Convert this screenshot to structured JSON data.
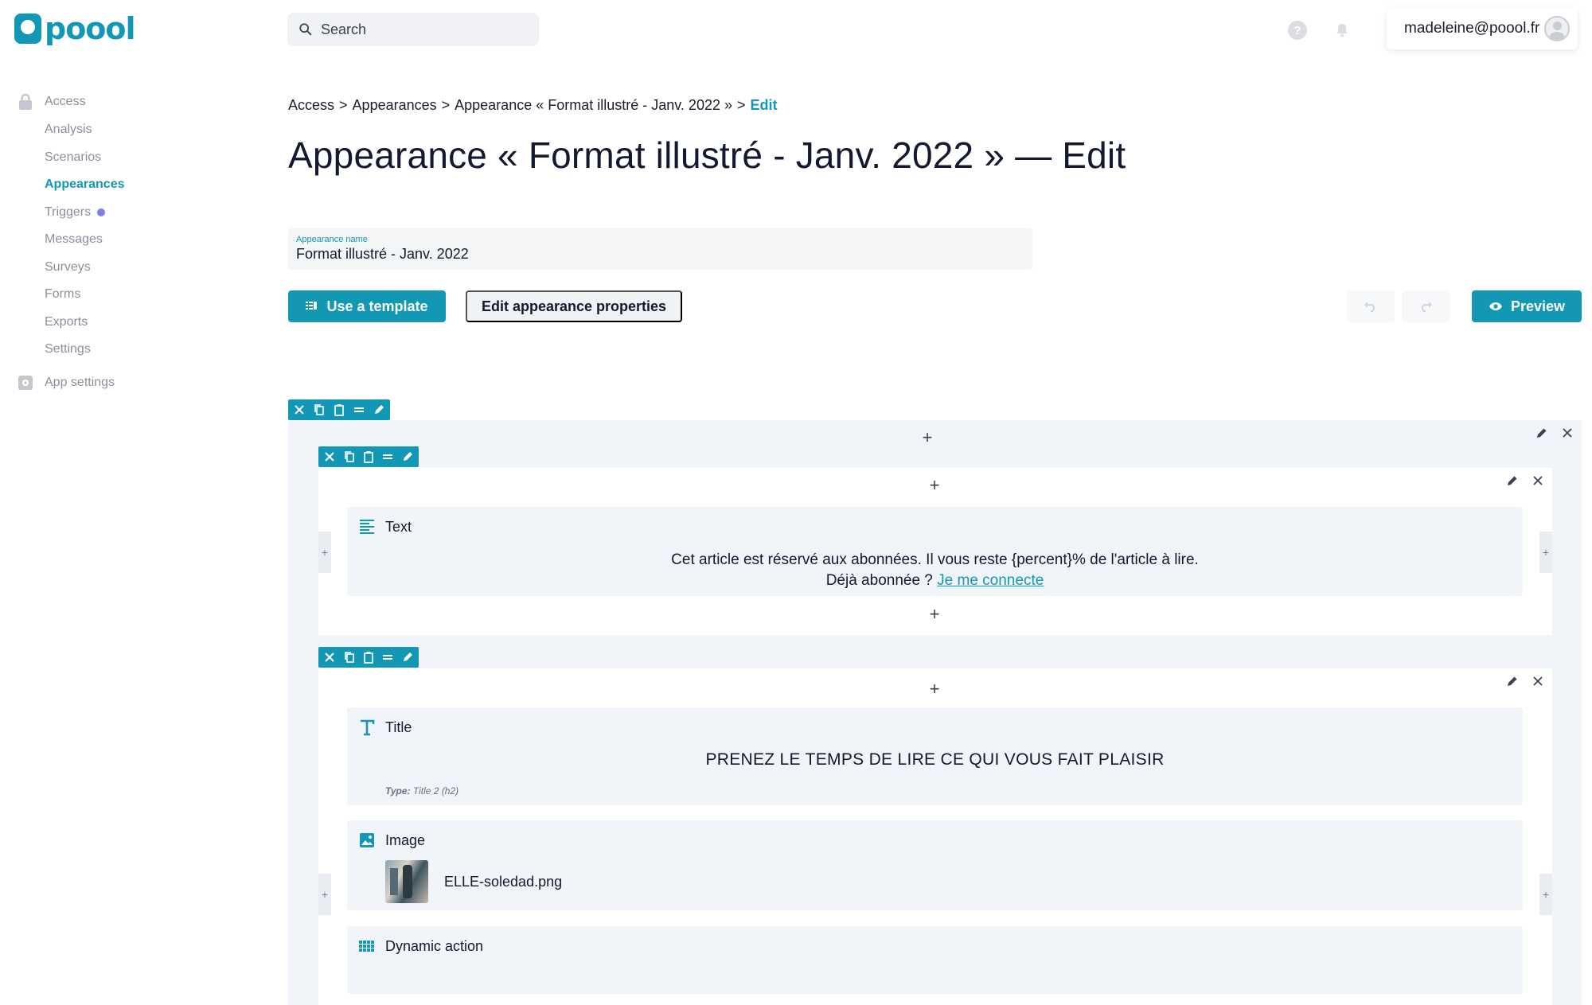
{
  "app": {
    "logo_text": "poool"
  },
  "header": {
    "search_placeholder": "Search",
    "user_email": "madeleine@poool.fr"
  },
  "sidebar": {
    "sections": [
      {
        "label": "Access",
        "icon": "lock-icon"
      },
      {
        "label": "App settings",
        "icon": "gear-icon"
      }
    ],
    "items": [
      {
        "label": "Analysis"
      },
      {
        "label": "Scenarios"
      },
      {
        "label": "Appearances",
        "active": true
      },
      {
        "label": "Triggers",
        "dot": true
      },
      {
        "label": "Messages"
      },
      {
        "label": "Surveys"
      },
      {
        "label": "Forms"
      },
      {
        "label": "Exports"
      },
      {
        "label": "Settings"
      }
    ]
  },
  "breadcrumb": {
    "items": [
      "Access",
      "Appearances",
      "Appearance « Format illustré - Janv. 2022 »",
      "Edit"
    ],
    "separator": ">"
  },
  "page_title": "Appearance « Format illustré - Janv. 2022 » — Edit",
  "form": {
    "name_label": "Appearance name",
    "name_value": "Format illustré - Janv. 2022"
  },
  "actions": {
    "use_template": "Use a template",
    "edit_properties": "Edit appearance properties",
    "preview": "Preview"
  },
  "builder": {
    "text_block": {
      "label": "Text",
      "line1": "Cet article est réservé aux abonnées. Il vous reste {percent}% de l'article à lire.",
      "line2_prefix": "Déjà abonnée ?",
      "line2_link": "Je me connecte"
    },
    "title_block": {
      "label": "Title",
      "content": "PRENEZ LE TEMPS DE LIRE CE QUI VOUS FAIT PLAISIR",
      "type_label": "Type:",
      "type_value": "Title 2 (h2)"
    },
    "image_block": {
      "label": "Image",
      "filename": "ELLE-soledad.png"
    },
    "dynamic_block": {
      "label": "Dynamic action"
    },
    "plus_symbol": "+"
  },
  "colors": {
    "accent": "#1298b5",
    "text": "#141830",
    "muted": "#8b8f9c",
    "panel": "#f1f4f8",
    "trigger_dot": "#7e7ee8"
  }
}
